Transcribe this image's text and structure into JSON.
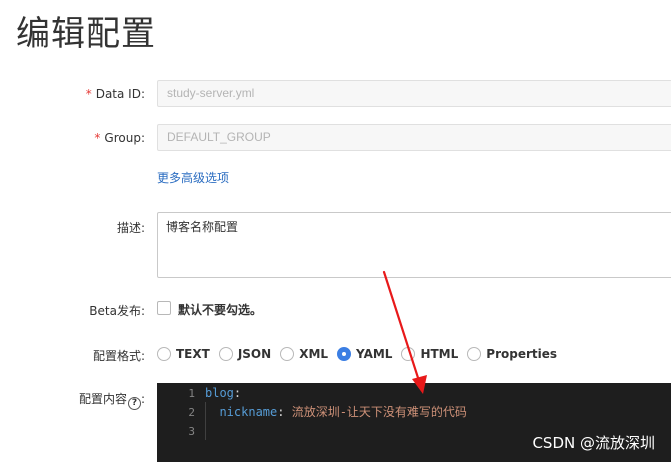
{
  "page": {
    "title": "编辑配置"
  },
  "form": {
    "data_id": {
      "label": "Data ID:",
      "value": "study-server.yml",
      "required_mark": "*"
    },
    "group": {
      "label": "Group:",
      "value": "DEFAULT_GROUP",
      "required_mark": "*"
    },
    "advanced_link": "更多高级选项",
    "description": {
      "label": "描述:",
      "value": "博客名称配置"
    },
    "beta": {
      "label": "Beta发布:",
      "checkbox_label": "默认不要勾选。",
      "checked": false
    },
    "format": {
      "label": "配置格式:",
      "options": [
        "TEXT",
        "JSON",
        "XML",
        "YAML",
        "HTML",
        "Properties"
      ],
      "selected": "YAML"
    },
    "content": {
      "label": "配置内容",
      "help_glyph": "?",
      "colon": ":",
      "lines": [
        {
          "num": "1",
          "key": "blog",
          "sep": ":",
          "value": ""
        },
        {
          "num": "2",
          "indent": "  ",
          "key": "nickname",
          "sep": ": ",
          "value": "流放深圳-让天下没有难写的代码"
        },
        {
          "num": "3",
          "key": "",
          "sep": "",
          "value": ""
        }
      ]
    }
  },
  "watermark": "CSDN @流放深圳",
  "colors": {
    "required": "#e53935",
    "link": "#2b6dc1",
    "radio_selected": "#3b7ee3",
    "editor_bg": "#1e1e1e",
    "yaml_key": "#569cd6",
    "yaml_value": "#ce9178",
    "annotation_arrow": "#e8191a"
  }
}
